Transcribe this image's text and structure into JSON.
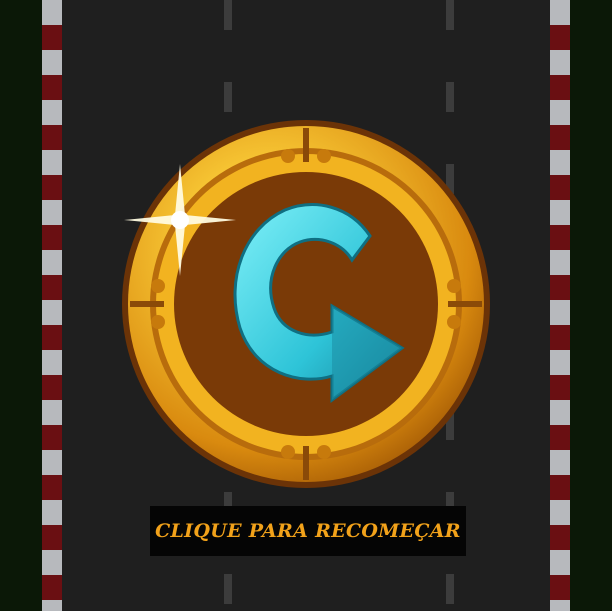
{
  "scene": {
    "restart_icon": "restart-arrow-icon",
    "restart_label": "CLIQUE PARA RECOMEÇAR"
  },
  "colors": {
    "grass": "#0b1807",
    "road": "#1f1f1f",
    "curb_red": "#6a0f12",
    "curb_white": "#b7b9bd",
    "gold": "#f4b31c",
    "badge_inner": "#7a3a07",
    "arrow": "#2ec4d8",
    "label_text": "#f2a21a"
  }
}
